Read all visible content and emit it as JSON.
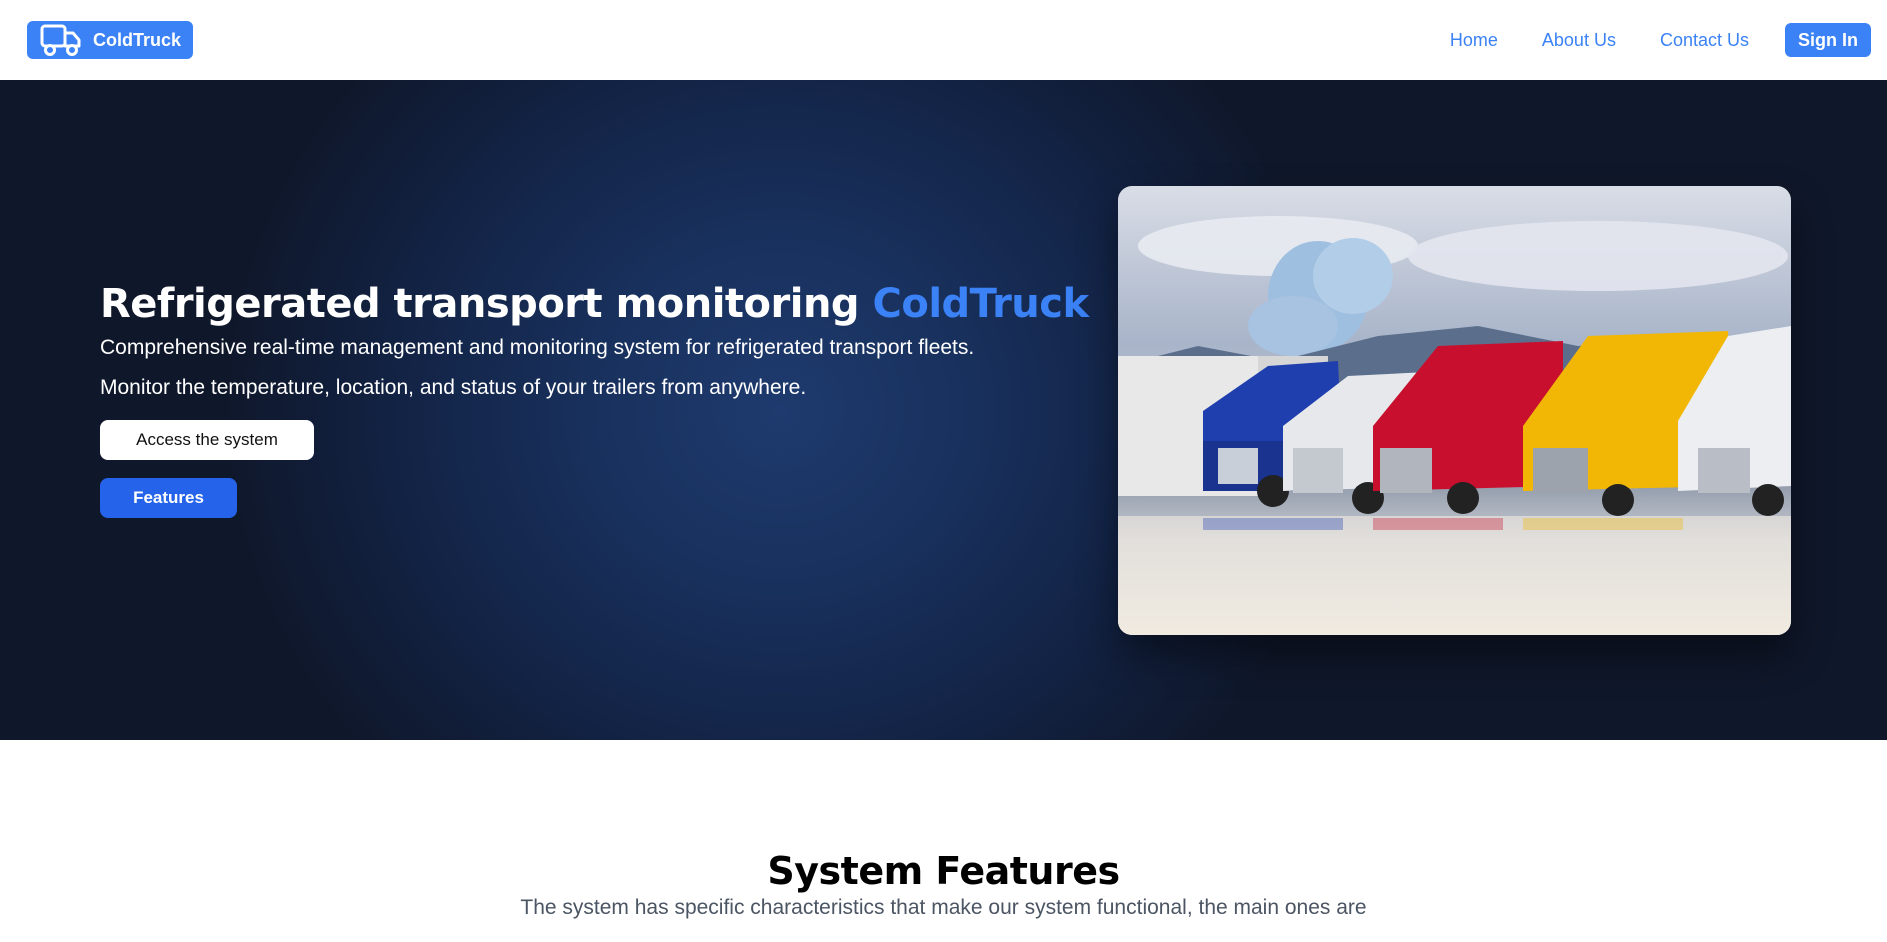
{
  "header": {
    "brand_name": "ColdTruck",
    "brand_icon": "truck-icon",
    "nav_links": [
      "Home",
      "About Us",
      "Contact Us"
    ],
    "signin_label": "Sign In"
  },
  "hero": {
    "title_main": "Refrigerated transport monitoring ",
    "title_accent": "ColdTruck",
    "description_line1": "Comprehensive real-time management and monitoring system for refrigerated transport fleets.",
    "description_line2": "Monitor the temperature, location, and status of your trailers from anywhere.",
    "access_button": "Access the system",
    "features_button": "Features"
  },
  "features": {
    "title": "System Features",
    "subtitle": "The system has specific characteristics that make our system functional, the main ones are"
  },
  "colors": {
    "accent": "#3b82f6",
    "hero_bg": "#0f172a",
    "button_blue": "#2563eb"
  }
}
